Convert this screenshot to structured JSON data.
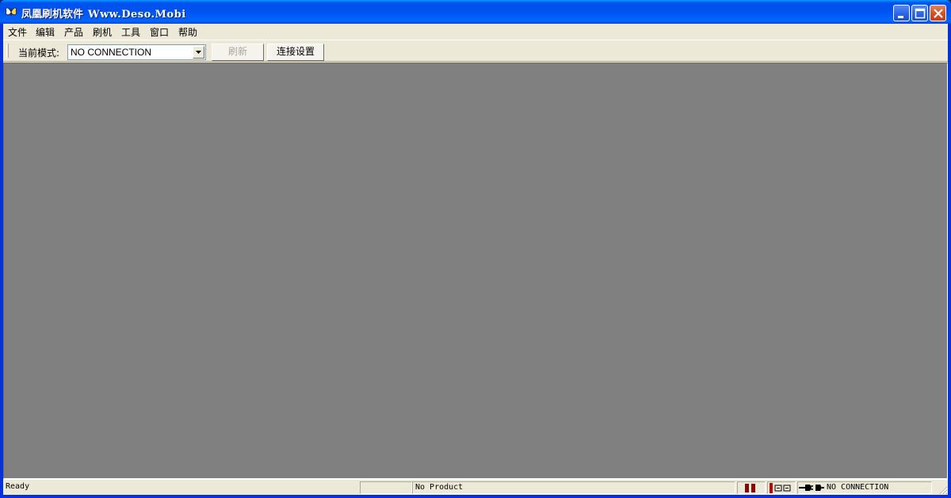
{
  "window": {
    "title": "凤凰刷机软件",
    "title_url": "Www.Deso.Mobi"
  },
  "menu": [
    "文件",
    "编辑",
    "产品",
    "刷机",
    "工具",
    "窗口",
    "帮助"
  ],
  "toolbar": {
    "mode_label": "当前模式:",
    "mode_value": "NO CONNECTION",
    "refresh_label": "刷新",
    "connect_settings_label": "连接设置"
  },
  "statusbar": {
    "status": "Ready",
    "product": "No Product",
    "connection": "NO CONNECTION"
  },
  "colors": {
    "titlebar": "#0058ee",
    "workspace": "#808080",
    "face": "#ece9d8"
  }
}
